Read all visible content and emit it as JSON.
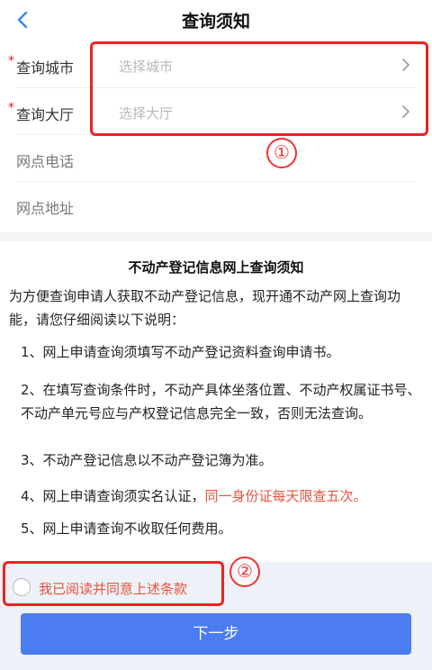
{
  "header": {
    "title": "查询须知"
  },
  "form": {
    "city": {
      "label": "查询城市",
      "placeholder": "选择城市"
    },
    "hall": {
      "label": "查询大厅",
      "placeholder": "选择大厅"
    },
    "phone": {
      "label": "网点电话"
    },
    "address": {
      "label": "网点地址"
    }
  },
  "annotations": {
    "one": "①",
    "two": "②"
  },
  "notice": {
    "title": "不动产登记信息网上查询须知",
    "intro": "为方便查询申请人获取不动产登记信息，现开通不动产网上查询功能，请您仔细阅读以下说明：",
    "item1": "1、网上申请查询须填写不动产登记资料查询申请书。",
    "item2": "2、在填写查询条件时，不动产具体坐落位置、不动产权属证书号、不动产单元号应与产权登记信息完全一致，否则无法查询。",
    "item3": "3、不动产登记信息以不动产登记簿为准。",
    "item4_prefix": "4、网上申请查询须实名认证，",
    "item4_highlight": "同一身份证每天限查五次。",
    "item5": "5、网上申请查询不收取任何费用。"
  },
  "agreement": {
    "label": "我已阅读并同意上述条款"
  },
  "footer": {
    "next_label": "下一步"
  },
  "colors": {
    "primary": "#4b7cf0",
    "highlight": "#e8533b",
    "required": "#e02020",
    "annotation": "#ee2222"
  }
}
